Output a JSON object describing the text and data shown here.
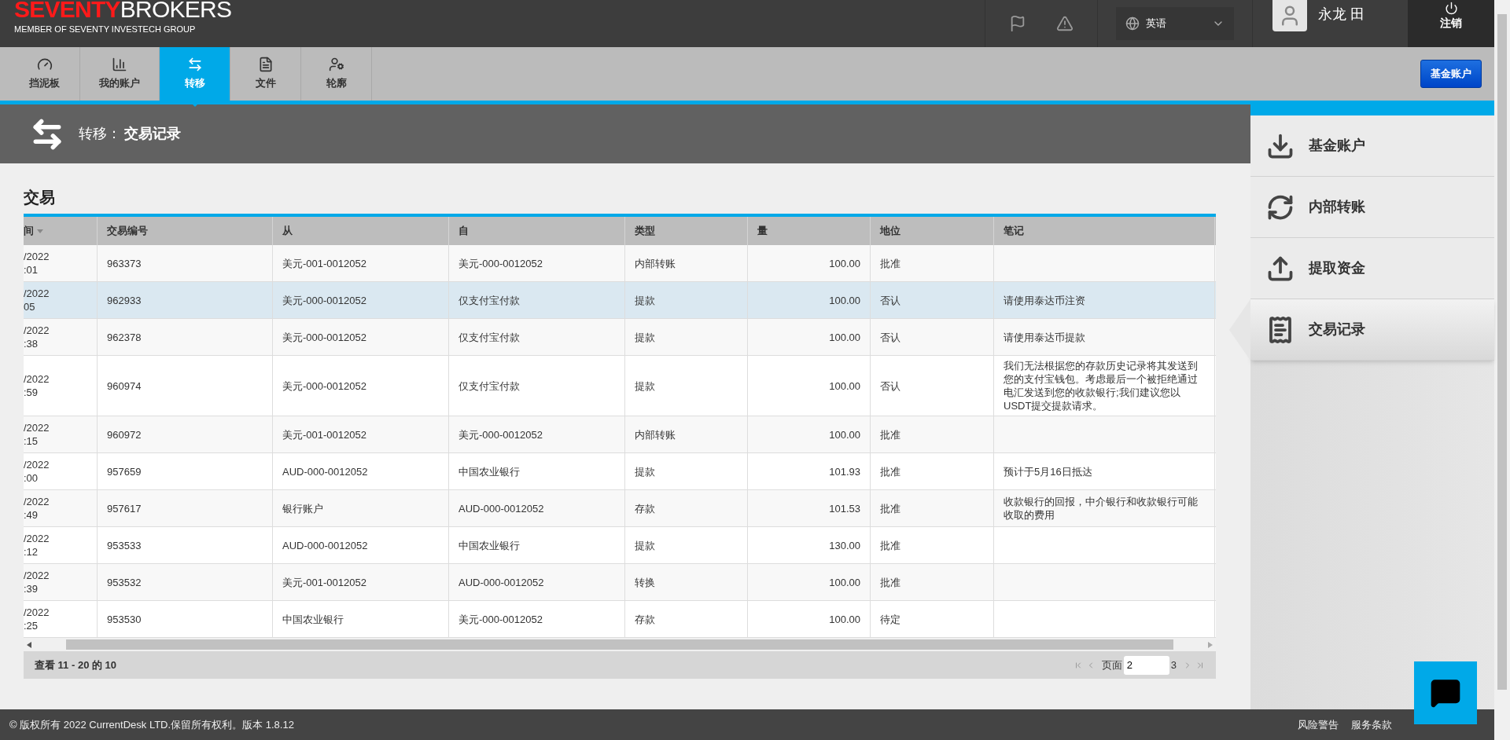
{
  "header": {
    "logo": {
      "part_1": "SEVENTY",
      "part_2": "BROKERS",
      "tagline": "MEMBER OF SEVENTY INVESTECH GROUP"
    },
    "language": "英语",
    "user_name": "永龙 田",
    "logout": "注销"
  },
  "nav": {
    "tabs": [
      {
        "label": "挡泥板",
        "selected": false
      },
      {
        "label": "我的账户",
        "selected": false
      },
      {
        "label": "转移",
        "selected": true
      },
      {
        "label": "文件",
        "selected": false
      },
      {
        "label": "轮廓",
        "selected": false
      }
    ],
    "button": "基金账户"
  },
  "page_title": {
    "section": "转移：",
    "title": "交易记录"
  },
  "sidebar": {
    "items": [
      {
        "kind": "deposit",
        "label": "基金账户",
        "selected": false
      },
      {
        "kind": "transfer",
        "label": "内部转账",
        "selected": false
      },
      {
        "kind": "withdraw",
        "label": "提取资金",
        "selected": false
      },
      {
        "kind": "history",
        "label": "交易记录",
        "selected": true
      }
    ]
  },
  "transactions": {
    "title": "交易",
    "columns": [
      {
        "label": "间",
        "sorted": true
      },
      {
        "label": "交易编号",
        "sorted": false
      },
      {
        "label": "从",
        "sorted": false
      },
      {
        "label": "自",
        "sorted": false
      },
      {
        "label": "类型",
        "sorted": false
      },
      {
        "label": "量",
        "sorted": false
      },
      {
        "label": "地位",
        "sorted": false
      },
      {
        "label": "笔记",
        "sorted": false
      }
    ],
    "rows": [
      {
        "selected": false,
        "cells": [
          "/2022\n:01",
          "963373",
          "美元-001-0012052",
          "美元-000-0012052",
          "内部转账",
          "100.00",
          "批准",
          ""
        ]
      },
      {
        "selected": true,
        "cells": [
          "/2022\n05",
          "962933",
          "美元-000-0012052",
          "仅支付宝付款",
          "提款",
          "100.00",
          "否认",
          "请使用泰达币注资"
        ]
      },
      {
        "selected": false,
        "cells": [
          "/2022\n:38",
          "962378",
          "美元-000-0012052",
          "仅支付宝付款",
          "提款",
          "100.00",
          "否认",
          "请使用泰达币提款"
        ]
      },
      {
        "selected": false,
        "cells": [
          "/2022\n:59",
          "960974",
          "美元-000-0012052",
          "仅支付宝付款",
          "提款",
          "100.00",
          "否认",
          "我们无法根据您的存款历史记录将其发送到您的支付宝钱包。考虑最后一个被拒绝通过电汇发送到您的收款银行;我们建议您以USDT提交提款请求。"
        ]
      },
      {
        "selected": false,
        "cells": [
          "/2022\n:15",
          "960972",
          "美元-001-0012052",
          "美元-000-0012052",
          "内部转账",
          "100.00",
          "批准",
          ""
        ]
      },
      {
        "selected": false,
        "cells": [
          "/2022\n:00",
          "957659",
          "AUD-000-0012052",
          "中国农业银行",
          "提款",
          "101.93",
          "批准",
          "预计于5月16日抵达"
        ]
      },
      {
        "selected": false,
        "cells": [
          "/2022\n:49",
          "957617",
          "银行账户",
          "AUD-000-0012052",
          "存款",
          "101.53",
          "批准",
          "收款银行的回报，中介银行和收款银行可能收取的费用"
        ]
      },
      {
        "selected": false,
        "cells": [
          "/2022\n:12",
          "953533",
          "AUD-000-0012052",
          "中国农业银行",
          "提款",
          "130.00",
          "批准",
          ""
        ]
      },
      {
        "selected": false,
        "cells": [
          "/2022\n:39",
          "953532",
          "美元-001-0012052",
          "AUD-000-0012052",
          "转换",
          "100.00",
          "批准",
          ""
        ]
      },
      {
        "selected": false,
        "cells": [
          "/2022\n:25",
          "953530",
          "中国农业银行",
          "美元-000-0012052",
          "存款",
          "100.00",
          "待定",
          ""
        ]
      }
    ],
    "pager": {
      "summary": "查看 11 - 20 的 10",
      "page_label": "页面",
      "page": "2",
      "total": "3"
    }
  },
  "footer": {
    "copyright": "© 版权所有 2022 CurrentDesk LTD.保留所有权利。版本 1.8.12",
    "links": [
      "风险警告",
      "服务条款"
    ]
  }
}
